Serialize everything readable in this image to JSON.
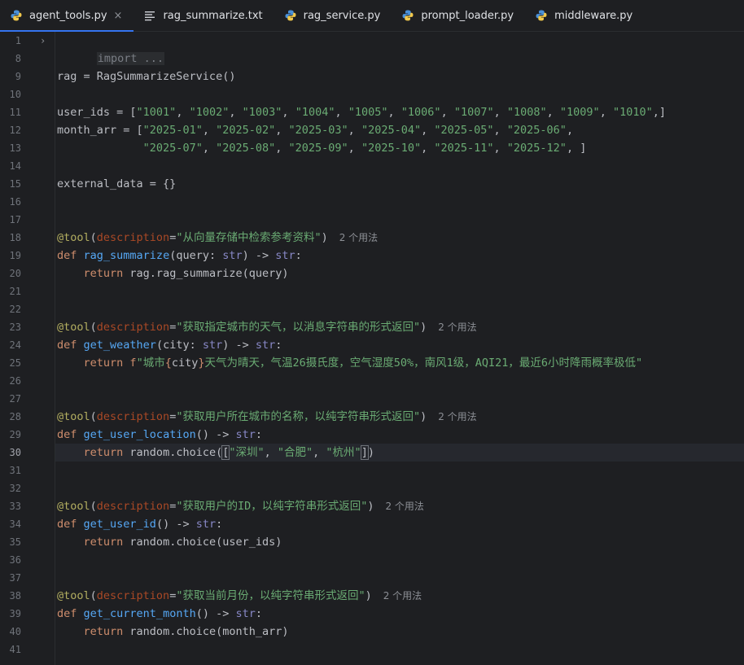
{
  "tabs": [
    {
      "label": "agent_tools.py",
      "icon": "python-icon",
      "active": true,
      "close": "×"
    },
    {
      "label": "rag_summarize.txt",
      "icon": "text-file-icon",
      "active": false
    },
    {
      "label": "rag_service.py",
      "icon": "python-icon",
      "active": false
    },
    {
      "label": "prompt_loader.py",
      "icon": "python-icon",
      "active": false
    },
    {
      "label": "middleware.py",
      "icon": "python-icon",
      "active": false
    }
  ],
  "gutter": {
    "line_numbers": [
      "1",
      "8",
      "9",
      "10",
      "11",
      "12",
      "13",
      "14",
      "15",
      "16",
      "17",
      "18",
      "19",
      "20",
      "21",
      "22",
      "23",
      "24",
      "25",
      "26",
      "27",
      "28",
      "29",
      "30",
      "31",
      "32",
      "33",
      "34",
      "35",
      "36",
      "37",
      "38",
      "39",
      "40",
      "41"
    ],
    "current_line": "30",
    "fold_marker": "›"
  },
  "code": {
    "l1_import": "import ...",
    "l9_a": "rag = RagSummarizeService()",
    "l11_a": "user_ids = [",
    "l11_items": [
      "\"1001\"",
      "\"1002\"",
      "\"1003\"",
      "\"1004\"",
      "\"1005\"",
      "\"1006\"",
      "\"1007\"",
      "\"1008\"",
      "\"1009\"",
      "\"1010\""
    ],
    "l11_end": ",]",
    "l12_a": "month_arr = [",
    "l12_items": [
      "\"2025-01\"",
      "\"2025-02\"",
      "\"2025-03\"",
      "\"2025-04\"",
      "\"2025-05\"",
      "\"2025-06\""
    ],
    "l13_items": [
      "\"2025-07\"",
      "\"2025-08\"",
      "\"2025-09\"",
      "\"2025-10\"",
      "\"2025-11\"",
      "\"2025-12\""
    ],
    "l13_end": " ]",
    "l15_a": "external_data = {}",
    "decorator": "@tool",
    "param_desc": "description",
    "kw_def": "def",
    "kw_return": "return",
    "type_str": "str",
    "arrow": " -> ",
    "usage_hint": "2 个用法",
    "l18_str": "\"从向量存储中检索参考资料\"",
    "l19_fn": "rag_summarize",
    "l19_args_a": "(query: ",
    "l19_args_b": ")",
    "l20_b": " rag.rag_summarize(query)",
    "l23_str": "\"获取指定城市的天气，以消息字符串的形式返回\"",
    "l24_fn": "get_weather",
    "l24_args_a": "(city: ",
    "l24_args_b": ")",
    "l25_f": " f",
    "l25_s1": "\"城市",
    "l25_brace_open": "{",
    "l25_var": "city",
    "l25_brace_close": "}",
    "l25_s2": "天气为晴天，气温26摄氏度，空气湿度50%，南风1级，AQI21，最近6小时降雨概率极低\"",
    "l28_str": "\"获取用户所在城市的名称，以纯字符串形式返回\"",
    "l29_fn": "get_user_location",
    "empty_args": "()",
    "l30_a": " random.choice(",
    "l30_b": "[",
    "l30_items": [
      "\"深圳\"",
      "\"合肥\"",
      "\"杭州\""
    ],
    "l30_c": "]",
    "l30_d": ")",
    "l33_str": "\"获取用户的ID，以纯字符串形式返回\"",
    "l34_fn": "get_user_id",
    "l35_b": " random.choice(user_ids)",
    "l38_str": "\"获取当前月份，以纯字符串形式返回\"",
    "l39_fn": "get_current_month",
    "l40_b": " random.choice(month_arr)"
  },
  "colors": {
    "background": "#1e1f22",
    "keyword": "#cf8e6d",
    "function": "#56a8f5",
    "decorator": "#b3ae60",
    "string": "#6aab73",
    "param_name": "#aa4926",
    "accent": "#3574f0"
  }
}
